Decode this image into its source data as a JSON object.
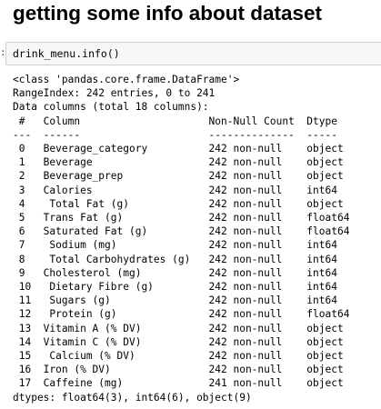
{
  "heading": "getting some info about dataset",
  "prompt": ":",
  "input_code": "drink_menu.info()",
  "output": {
    "class_line": "<class 'pandas.core.frame.DataFrame'>",
    "range_index": "RangeIndex: 242 entries, 0 to 241",
    "data_columns": "Data columns (total 18 columns):",
    "header": " #   Column                     Non-Null Count  Dtype  ",
    "separator": "---  ------                     --------------  -----  ",
    "rows": [
      " 0   Beverage_category          242 non-null    object ",
      " 1   Beverage                   242 non-null    object ",
      " 2   Beverage_prep              242 non-null    object ",
      " 3   Calories                   242 non-null    int64  ",
      " 4    Total Fat (g)             242 non-null    object ",
      " 5   Trans Fat (g)              242 non-null    float64",
      " 6   Saturated Fat (g)          242 non-null    float64",
      " 7    Sodium (mg)               242 non-null    int64  ",
      " 8    Total Carbohydrates (g)   242 non-null    int64  ",
      " 9   Cholesterol (mg)           242 non-null    int64  ",
      " 10   Dietary Fibre (g)         242 non-null    int64  ",
      " 11   Sugars (g)                242 non-null    int64  ",
      " 12   Protein (g)               242 non-null    float64",
      " 13  Vitamin A (% DV)           242 non-null    object ",
      " 14  Vitamin C (% DV)           242 non-null    object ",
      " 15   Calcium (% DV)            242 non-null    object ",
      " 16  Iron (% DV)                242 non-null    object ",
      " 17  Caffeine (mg)              241 non-null    object "
    ],
    "dtypes": "dtypes: float64(3), int64(6), object(9)"
  }
}
